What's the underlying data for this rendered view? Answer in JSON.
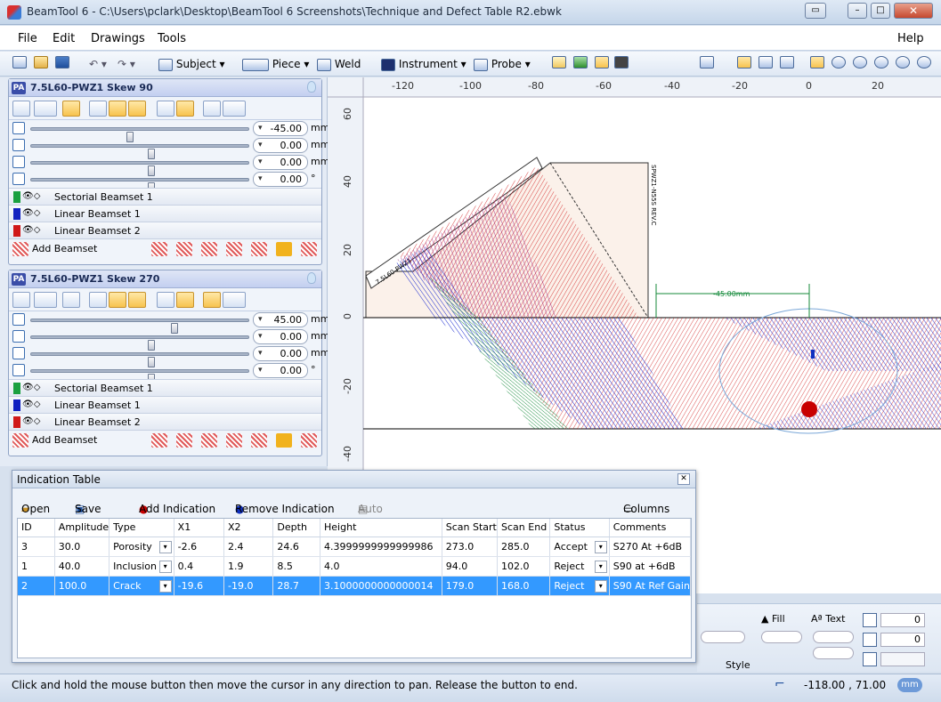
{
  "window": {
    "title": "BeamTool 6 - C:\\Users\\pclark\\Desktop\\BeamTool 6 Screenshots\\Technique and Defect Table R2.ebwk"
  },
  "menu": {
    "file": "File",
    "edit": "Edit",
    "drawings": "Drawings",
    "tools": "Tools",
    "help": "Help"
  },
  "toolbar": {
    "subject": "Subject",
    "piece": "Piece",
    "weld": "Weld",
    "instrument": "Instrument",
    "probe": "Probe"
  },
  "probes": [
    {
      "badge": "PA",
      "name": "7.5L60-PWZ1 Skew 90",
      "sliders": [
        {
          "value": "-45.00",
          "unit": "mm",
          "level": 0.45
        },
        {
          "value": "0.00",
          "unit": "mm",
          "level": 0.55
        },
        {
          "value": "0.00",
          "unit": "mm",
          "level": 0.55
        },
        {
          "value": "0.00",
          "unit": "°",
          "level": 0.55
        }
      ],
      "beamsets": [
        {
          "name": "Sectorial Beamset 1",
          "color": "#1aa040"
        },
        {
          "name": "Linear Beamset 1",
          "color": "#1020c0"
        },
        {
          "name": "Linear Beamset 2",
          "color": "#d01818"
        }
      ],
      "add_label": "Add Beamset"
    },
    {
      "badge": "PA",
      "name": "7.5L60-PWZ1 Skew 270",
      "sliders": [
        {
          "value": "45.00",
          "unit": "mm",
          "level": 0.66
        },
        {
          "value": "0.00",
          "unit": "mm",
          "level": 0.55
        },
        {
          "value": "0.00",
          "unit": "mm",
          "level": 0.55
        },
        {
          "value": "0.00",
          "unit": "°",
          "level": 0.55
        }
      ],
      "beamsets": [
        {
          "name": "Sectorial Beamset 1",
          "color": "#1aa040"
        },
        {
          "name": "Linear Beamset 1",
          "color": "#1020c0"
        },
        {
          "name": "Linear Beamset 2",
          "color": "#d01818"
        }
      ],
      "add_label": "Add Beamset"
    }
  ],
  "drawing": {
    "ruler_top": [
      "-120",
      "-100",
      "-80",
      "-60",
      "-40",
      "-20",
      "0",
      "20"
    ],
    "ruler_left": [
      "60",
      "40",
      "20",
      "0",
      "-20",
      "-40"
    ],
    "probe_label": "7.5L60-PWZ1",
    "wedge_label": "SPWZ1-N55S REV.C",
    "dimension": "-45.00mm"
  },
  "indication_table": {
    "title": "Indication Table",
    "buttons": {
      "open": "Open",
      "save": "Save",
      "add": "Add Indication",
      "remove": "Remove Indication",
      "auto": "Auto",
      "columns": "Columns"
    },
    "columns": [
      "ID",
      "Amplitude",
      "Type",
      "X1",
      "X2",
      "Depth",
      "Height",
      "Scan Start",
      "Scan End",
      "Status",
      "Comments"
    ],
    "rows": [
      [
        "3",
        "30.0",
        "Porosity",
        "-2.6",
        "2.4",
        "24.6",
        "4.3999999999999986",
        "273.0",
        "285.0",
        "Accept",
        "S270 At +6dB"
      ],
      [
        "1",
        "40.0",
        "Inclusion",
        "0.4",
        "1.9",
        "8.5",
        "4.0",
        "94.0",
        "102.0",
        "Reject",
        "S90 at +6dB"
      ],
      [
        "2",
        "100.0",
        "Crack",
        "-19.6",
        "-19.0",
        "28.7",
        "3.1000000000000014",
        "179.0",
        "168.0",
        "Reject",
        "S90 At Ref Gain"
      ]
    ],
    "selected_row": 2
  },
  "ribbon": {
    "fill": "Fill",
    "text": "Text",
    "style": "Style",
    "val1": "0",
    "val2": "0"
  },
  "status": {
    "message": "Click and hold the mouse button then move the cursor in any direction to pan. Release the button to end.",
    "coords": "-118.00 , 71.00",
    "unit": "mm"
  }
}
